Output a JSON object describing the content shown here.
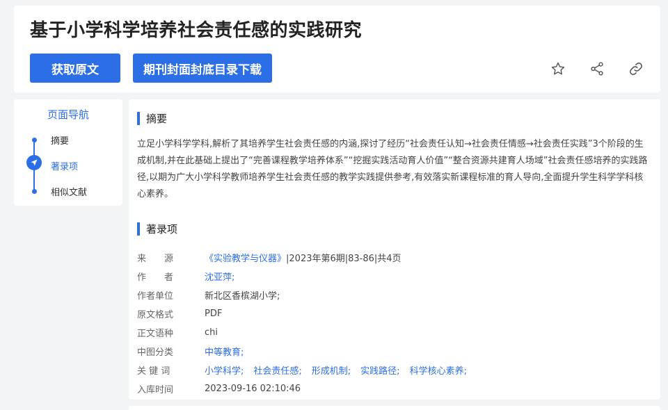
{
  "article": {
    "title": "基于小学科学培养社会责任感的实践研究",
    "get_original_label": "获取原文",
    "journal_download_label": "期刊封面封底目录下载"
  },
  "icons": {
    "favorite": "star-icon",
    "share": "share-icon",
    "link": "link-icon"
  },
  "nav": {
    "title": "页面导航",
    "items": [
      "摘要",
      "著录项",
      "相似文献"
    ],
    "active_index": 1
  },
  "abstract": {
    "heading": "摘要",
    "text": "立足小学科学学科,解析了其培养学生社会责任感的内涵,探讨了经历“社会责任认知→社会责任情感→社会责任实践”3个阶段的生成机制,并在此基础上提出了“完善课程教学培养体系”“挖掘实践活动育人价值”“整合资源共建育人场域”社会责任感培养的实践路径,以期为广大小学科学教师培养学生社会责任感的教学实践提供参考,有效落实新课程标准的育人导向,全面提升学生科学学科核心素养。"
  },
  "record": {
    "heading": "著录项",
    "source_label": "来　　源",
    "source_journal": "《实验教学与仪器》",
    "source_detail": "|2023年第6期|83-86|共4页",
    "author_label": "作　　者",
    "author": "沈亚萍;",
    "affiliation_label": "作者单位",
    "affiliation": "新北区香槟湖小学;",
    "format_label": "原文格式",
    "format": "PDF",
    "language_label": "正文语种",
    "language": "chi",
    "classification_label": "中图分类",
    "classification": "中等教育;",
    "keywords_label": "关 键 词",
    "keywords": [
      "小学科学;",
      "社会责任感;",
      "形成机制;",
      "实践路径;",
      "科学核心素养;"
    ],
    "indexed_label": "入库时间",
    "indexed_time": "2023-09-16 02:10:46"
  },
  "colors": {
    "accent": "#2b6ee6",
    "background": "#f3f4f6"
  }
}
